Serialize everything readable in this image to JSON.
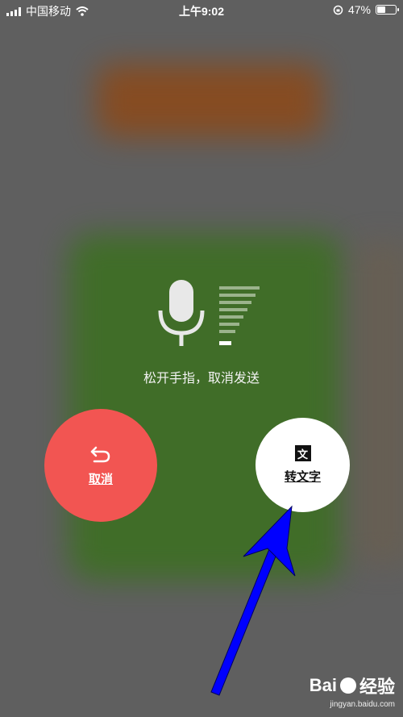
{
  "status_bar": {
    "carrier": "中国移动",
    "time": "上午9:02",
    "battery": "47%",
    "battery_level": 0.47
  },
  "voice": {
    "hint": "松开手指，取消发送"
  },
  "cancel_button": {
    "label": "取消",
    "color": "#f25552"
  },
  "convert_button": {
    "label": "转文字",
    "icon_char": "文"
  },
  "annotation": {
    "arrow_color": "#0000ff"
  },
  "watermark": {
    "brand": "Bai",
    "brand_suffix": "经验",
    "url": "jingyan.baidu.com"
  }
}
